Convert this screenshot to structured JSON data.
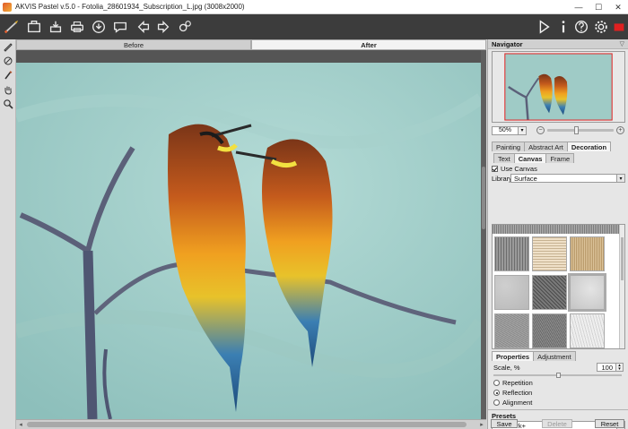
{
  "window": {
    "title": "AKVIS Pastel v.5.0 - Fotolia_28601934_Subscription_L.jpg (3008x2000)",
    "minimize": "—",
    "maximize": "☐",
    "close": "✕"
  },
  "toolbar": {
    "left_icons": [
      "brush-logo-icon",
      "open-icon",
      "save-icon",
      "print-icon",
      "share-icon",
      "back-icon",
      "forward-icon",
      "batch-icon"
    ],
    "right_icons": [
      "run-icon",
      "info-icon",
      "help-icon",
      "settings-icon",
      "tray-icon"
    ]
  },
  "left_tools": [
    "pencil-icon",
    "eraser-icon",
    "stamp-icon",
    "hand-icon",
    "zoom-icon"
  ],
  "view_tabs": {
    "before": "Before",
    "after": "After",
    "active": "after"
  },
  "navigator": {
    "title": "Navigator",
    "zoom_value": "50%",
    "zoom_out": "−",
    "zoom_in": "+"
  },
  "main_tabs": [
    {
      "label": "Painting"
    },
    {
      "label": "Abstract Art"
    },
    {
      "label": "Decoration",
      "active": true
    }
  ],
  "sub_tabs": [
    {
      "label": "Text"
    },
    {
      "label": "Canvas",
      "active": true
    },
    {
      "label": "Frame"
    }
  ],
  "canvas_settings": {
    "use_canvas_label": "Use Canvas",
    "use_canvas_checked": true,
    "library_label": "Library",
    "library_value": "Surface"
  },
  "texture_thumbnails": {
    "columns": 3,
    "visible_rows": 3,
    "selected_index": 5
  },
  "props_tabs": [
    {
      "label": "Properties",
      "active": true
    },
    {
      "label": "Adjustment"
    }
  ],
  "properties": {
    "scale_label": "Scale, %",
    "scale_value": "100",
    "scale_fraction": 0.5,
    "modes": [
      {
        "label": "Repetition",
        "checked": false
      },
      {
        "label": "Reflection",
        "checked": true
      },
      {
        "label": "Alignment",
        "checked": false
      }
    ]
  },
  "presets": {
    "title": "Presets",
    "value": "howwork+",
    "save": "Save",
    "delete": "Delete",
    "reset": "Reset"
  },
  "colors": {
    "toolbar_bg": "#3c3c3c",
    "canvas_bg": "#9ec9c4",
    "record_red": "#e02020"
  }
}
